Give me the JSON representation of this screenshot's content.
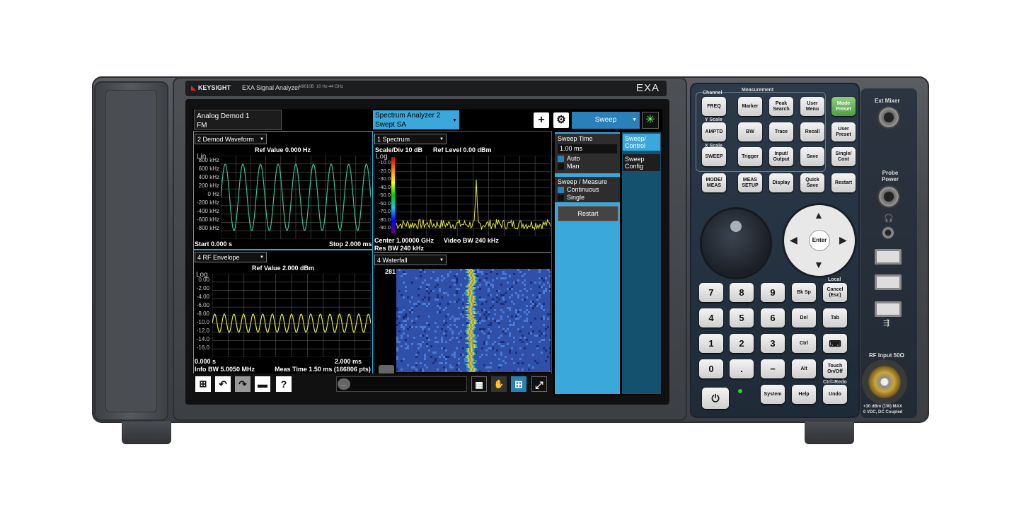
{
  "brand": {
    "logo": "KEYSIGHT",
    "model": "EXA Signal Analyzer",
    "model_number": "N9010B",
    "freq_range": "10 Hz-44 GHz",
    "series": "EXA"
  },
  "screen": {
    "tab_left": {
      "line1": "Analog Demod 1",
      "line2": "FM"
    },
    "tab_right": {
      "line1": "Spectrum Analyzer 2",
      "line2": "Swept SA"
    },
    "plus_label": "+",
    "sweep_select": "Sweep",
    "win1": {
      "dropdown": "2 Demod Waveform",
      "title": "Ref Value 0.000 Hz",
      "scale": "Lin",
      "yticks": [
        "800 kHz",
        "600 kHz",
        "400 kHz",
        "200 kHz",
        "0 Hz",
        "-200 kHz",
        "-400 kHz",
        "-600 kHz",
        "-800 kHz"
      ],
      "footer_left": "Start 0.000 s",
      "footer_right": "Stop 2.000 ms",
      "trace_color": "#39c38f"
    },
    "win2": {
      "dropdown": "1 Spectrum",
      "scale_div": "Scale/Div 10 dB",
      "ref_level": "Ref Level 0.00 dBm",
      "scale": "Log",
      "yticks": [
        "-10.0",
        "-20.0",
        "-30.0",
        "-40.0",
        "-50.0",
        "-60.0",
        "-70.0",
        "-80.0",
        "-90.0"
      ],
      "footer_center": "Center 1.00000 GHz",
      "footer_vbw": "Video BW 240 kHz",
      "footer_rbw": "Res BW 240 kHz",
      "trace_color": "#e6e63a"
    },
    "win3": {
      "dropdown": "4 RF Envelope",
      "title": "Ref Value 2.000 dBm",
      "scale": "Log",
      "yticks": [
        "0.00",
        "-2.00",
        "-4.00",
        "-6.00",
        "-8.00",
        "-10.0",
        "-12.0",
        "-14.0",
        "-16.0"
      ],
      "footer_left": "0.000 s",
      "footer_right": "2.000 ms",
      "footer2_left": "Info BW 5.0050 MHz",
      "footer2_right": "Meas Time 1.50 ms (166806 pts)",
      "trace_color": "#e6e63a"
    },
    "win4": {
      "dropdown": "4 Waterfall",
      "count": "281"
    },
    "menu": {
      "sweep_time_label": "Sweep Time",
      "sweep_time_value": "1.00 ms",
      "auto": "Auto",
      "man": "Man",
      "sweep_measure": "Sweep / Measure",
      "continuous": "Continuous",
      "single": "Single",
      "restart": "Restart"
    },
    "side_tabs": [
      {
        "line1": "Sweep/",
        "line2": "Control"
      },
      {
        "line1": "Sweep",
        "line2": "Config"
      }
    ]
  },
  "panel": {
    "group_channel": "Channel",
    "group_measurement": "Measurement",
    "y_scale": "Y Scale",
    "x_scale": "X Scale",
    "keys": {
      "freq": "FREQ",
      "marker": "Marker",
      "peak_search": "Peak Search",
      "user_menu": "User Menu",
      "mode_preset": "Mode Preset",
      "amptd": "AMPTD",
      "bw": "BW",
      "trace": "Trace",
      "recall": "Recall",
      "user_preset": "User Preset",
      "sweep": "SWEEP",
      "trigger": "Trigger",
      "input_output": "Input/ Output",
      "save": "Save",
      "single_cont": "Single/ Cont",
      "mode_meas": "MODE/ MEAS",
      "meas_setup": "MEAS SETUP",
      "display": "Display",
      "quick_save": "Quick Save",
      "restart": "Restart",
      "enter": "Enter",
      "local": "Local",
      "bksp": "Bk Sp",
      "cancel": "Cancel (Esc)",
      "tab": "Tab",
      "del": "Del",
      "ctrl": "Ctrl",
      "alt": "Alt",
      "touch": "Touch On/Off",
      "ctrl_redo": "Ctrl=Redo",
      "system": "System",
      "help": "Help",
      "undo": "Undo",
      "minus": "−",
      "dot": "."
    },
    "numkeys": [
      "7",
      "8",
      "9",
      "4",
      "5",
      "6",
      "1",
      "2",
      "3",
      "0"
    ],
    "ext_mixer": "Ext Mixer",
    "probe_power": "Probe Power",
    "rf_input": "RF Input 50Ω",
    "rf_warning_1": "+30 dBm (1W) MAX",
    "rf_warning_2": "0 VDC, DC Coupled"
  }
}
